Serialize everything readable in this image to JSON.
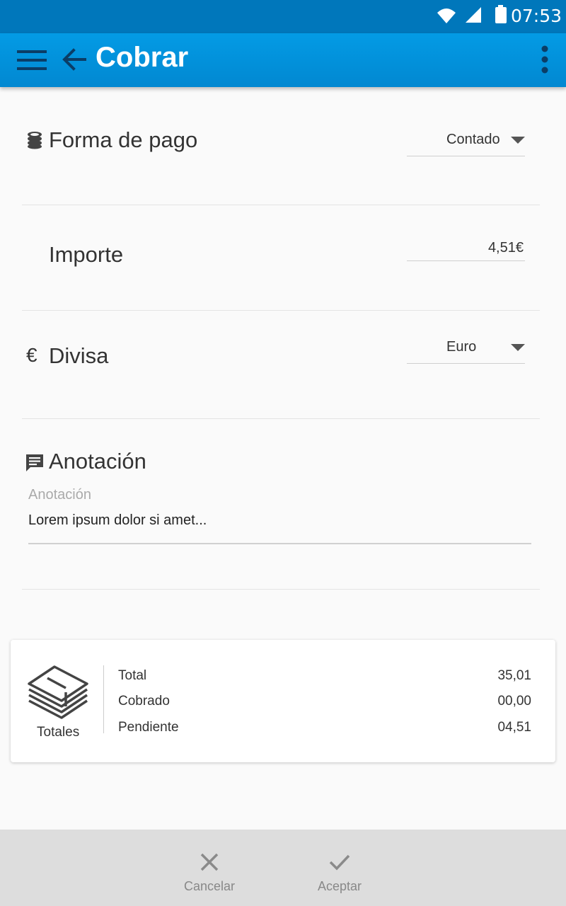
{
  "status_bar": {
    "time": "07:53",
    "icons": [
      "wifi-icon",
      "signal-icon",
      "battery-icon"
    ]
  },
  "app_bar": {
    "title": "Cobrar",
    "icons": [
      "menu-icon",
      "back-arrow-icon",
      "overflow-menu-icon"
    ]
  },
  "form": {
    "payment_method": {
      "label": "Forma de pago",
      "icon": "coins-icon",
      "value": "Contado"
    },
    "amount": {
      "label": "Importe",
      "value": "4,51€"
    },
    "currency": {
      "label": "Divisa",
      "icon_glyph": "€",
      "value": "Euro"
    },
    "annotation": {
      "label": "Anotación",
      "icon": "comment-icon",
      "field_label": "Anotación",
      "value": "Lorem ipsum dolor si amet..."
    }
  },
  "totals": {
    "label": "Totales",
    "icon": "money-stack-icon",
    "rows": [
      {
        "label": "Total",
        "value": "35,01"
      },
      {
        "label": "Cobrado",
        "value": "00,00"
      },
      {
        "label": "Pendiente",
        "value": "04,51"
      }
    ]
  },
  "bottom_bar": {
    "cancel_label": "Cancelar",
    "accept_label": "Aceptar"
  },
  "colors": {
    "status_bar": "#0077bb",
    "app_bar": "#0288d1",
    "bottom_bar": "#dddddd"
  }
}
